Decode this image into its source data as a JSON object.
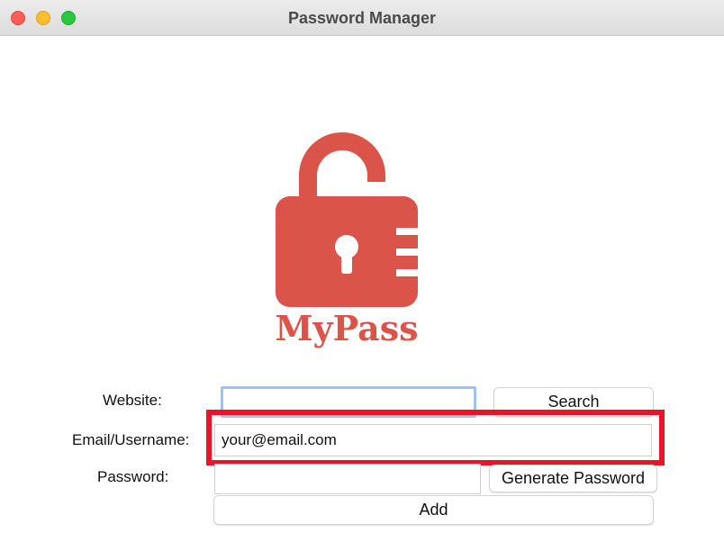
{
  "window": {
    "title": "Password Manager"
  },
  "logo": {
    "text": "MyPass",
    "icon": "padlock-icon",
    "color": "#db544a"
  },
  "form": {
    "website_label": "Website:",
    "website_value": "",
    "email_label": "Email/Username:",
    "email_value": "your@email.com",
    "password_label": "Password:",
    "password_value": ""
  },
  "buttons": {
    "search": "Search",
    "generate": "Generate Password",
    "add": "Add"
  },
  "colors": {
    "highlight": "#e8142a",
    "focus_ring": "#9cc3f3"
  }
}
